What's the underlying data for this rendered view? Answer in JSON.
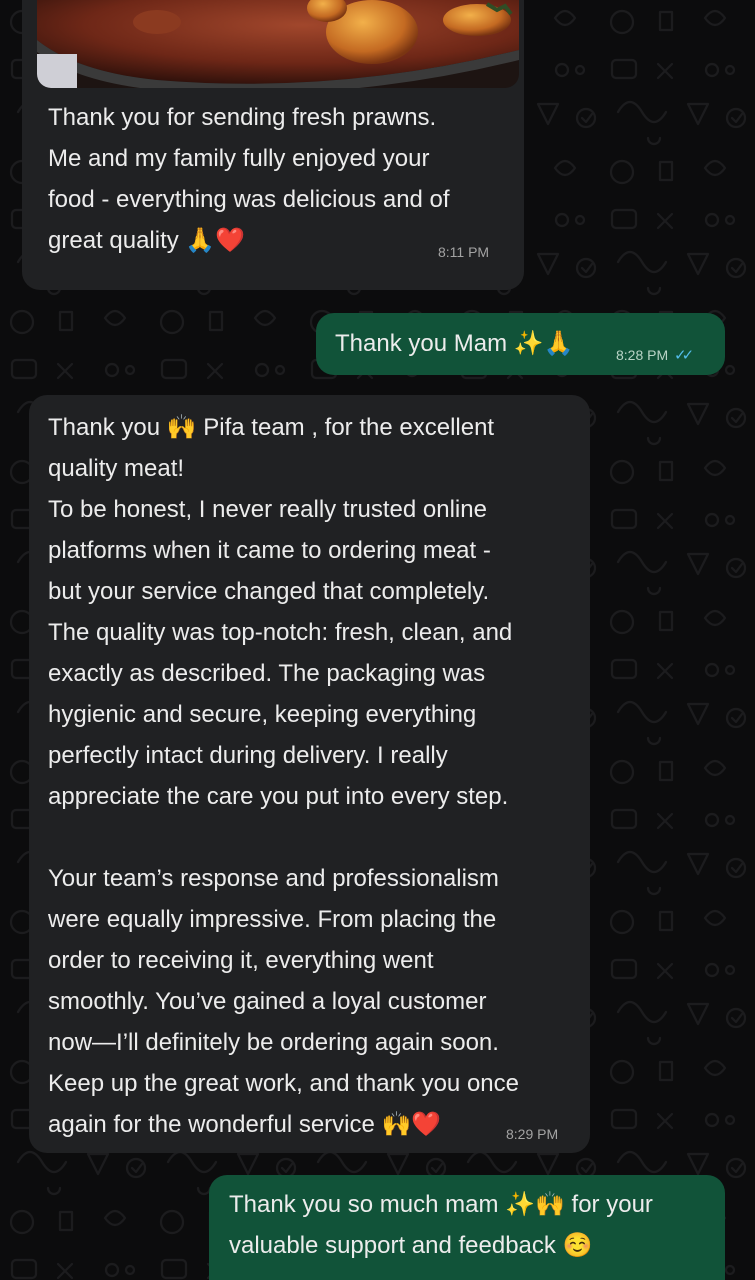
{
  "chat": {
    "messages": [
      {
        "id": "m1",
        "direction": "incoming",
        "has_image": true,
        "image_icon": "food-photo",
        "text": "Thank you for sending fresh prawns.\nMe and my family fully enjoyed your\nfood - everything was delicious and of\ngreat quality 🙏❤️",
        "time": "8:11 PM"
      },
      {
        "id": "m2",
        "direction": "outgoing",
        "text": "Thank you Mam ✨🙏",
        "time": "8:28 PM",
        "status": "read",
        "status_icon": "double-check-icon",
        "status_glyph": "✓✓"
      },
      {
        "id": "m3",
        "direction": "incoming",
        "text": "Thank you 🙌 Pifa team , for the excellent\nquality meat!\nTo be honest, I never really trusted online\nplatforms when it came to ordering meat -\nbut your service changed that completely.\nThe quality was top-notch: fresh, clean, and\nexactly as described. The packaging was\nhygienic and secure, keeping everything\nperfectly intact during delivery. I really\nappreciate the care you put into every step.\n\nYour team’s response and professionalism\nwere equally impressive. From placing the\norder to receiving it, everything went\nsmoothly. You’ve gained a loyal customer\nnow—I’ll definitely be ordering again soon.\nKeep up the great work, and thank you once\nagain for the wonderful service 🙌❤️",
        "time": "8:29 PM"
      },
      {
        "id": "m4",
        "direction": "outgoing",
        "text": "Thank you so much mam ✨🙌 for your\nvaluable support and feedback ☺️",
        "time": ""
      }
    ]
  },
  "colors": {
    "background": "#0c0c0d",
    "incoming_bubble": "#202123",
    "outgoing_bubble": "#115339",
    "read_ticks": "#53bdeb",
    "text": "#ececec"
  }
}
